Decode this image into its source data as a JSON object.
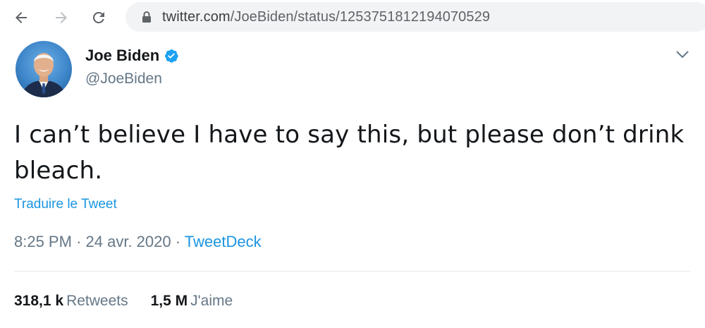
{
  "browser": {
    "url_domain": "twitter.com",
    "url_path": "/JoeBiden/status/1253751812194070529"
  },
  "tweet": {
    "author_name": "Joe Biden",
    "handle": "@JoeBiden",
    "text": "I can’t believe I have to say this, but please don’t drink bleach.",
    "translate_label": "Traduire le Tweet",
    "time": "8:25 PM",
    "date": "24 avr. 2020",
    "separator": "·",
    "source": "TweetDeck",
    "retweets_count": "318,1 k",
    "retweets_label": "Retweets",
    "likes_count": "1,5 M",
    "likes_label": "J'aime"
  },
  "colors": {
    "accent": "#1b95e0",
    "verified": "#1da1f2",
    "secondary_text": "#657786"
  },
  "icons": [
    "back-arrow-icon",
    "forward-arrow-icon",
    "reload-icon",
    "lock-icon",
    "verified-badge-icon",
    "chevron-down-icon"
  ]
}
